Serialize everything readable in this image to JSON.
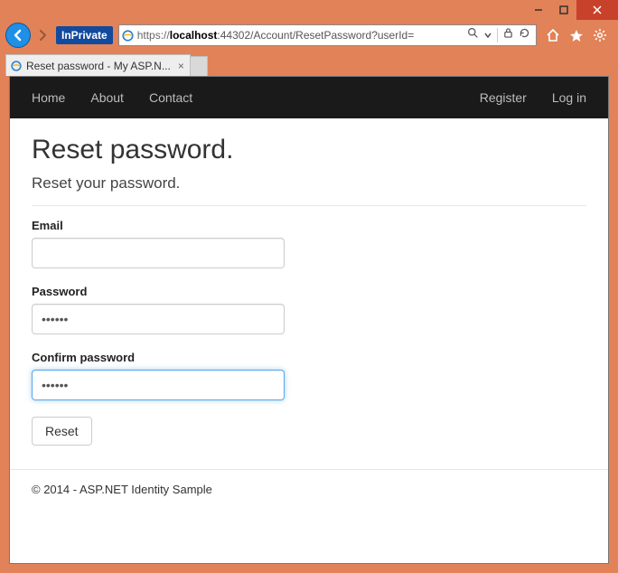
{
  "window": {
    "url_scheme": "https://",
    "url_host": "localhost",
    "url_port_path": ":44302/Account/ResetPassword?userId=",
    "inprivate_label": "InPrivate"
  },
  "tab": {
    "title": "Reset password - My ASP.N..."
  },
  "navbar": {
    "left": [
      "Home",
      "About",
      "Contact"
    ],
    "right": [
      "Register",
      "Log in"
    ]
  },
  "page": {
    "heading": "Reset password.",
    "subtitle": "Reset your password.",
    "form": {
      "email_label": "Email",
      "email_value": "",
      "password_label": "Password",
      "password_value": "••••••",
      "confirm_label": "Confirm password",
      "confirm_value": "••••••",
      "submit_label": "Reset"
    },
    "footer": "© 2014 - ASP.NET Identity Sample"
  }
}
